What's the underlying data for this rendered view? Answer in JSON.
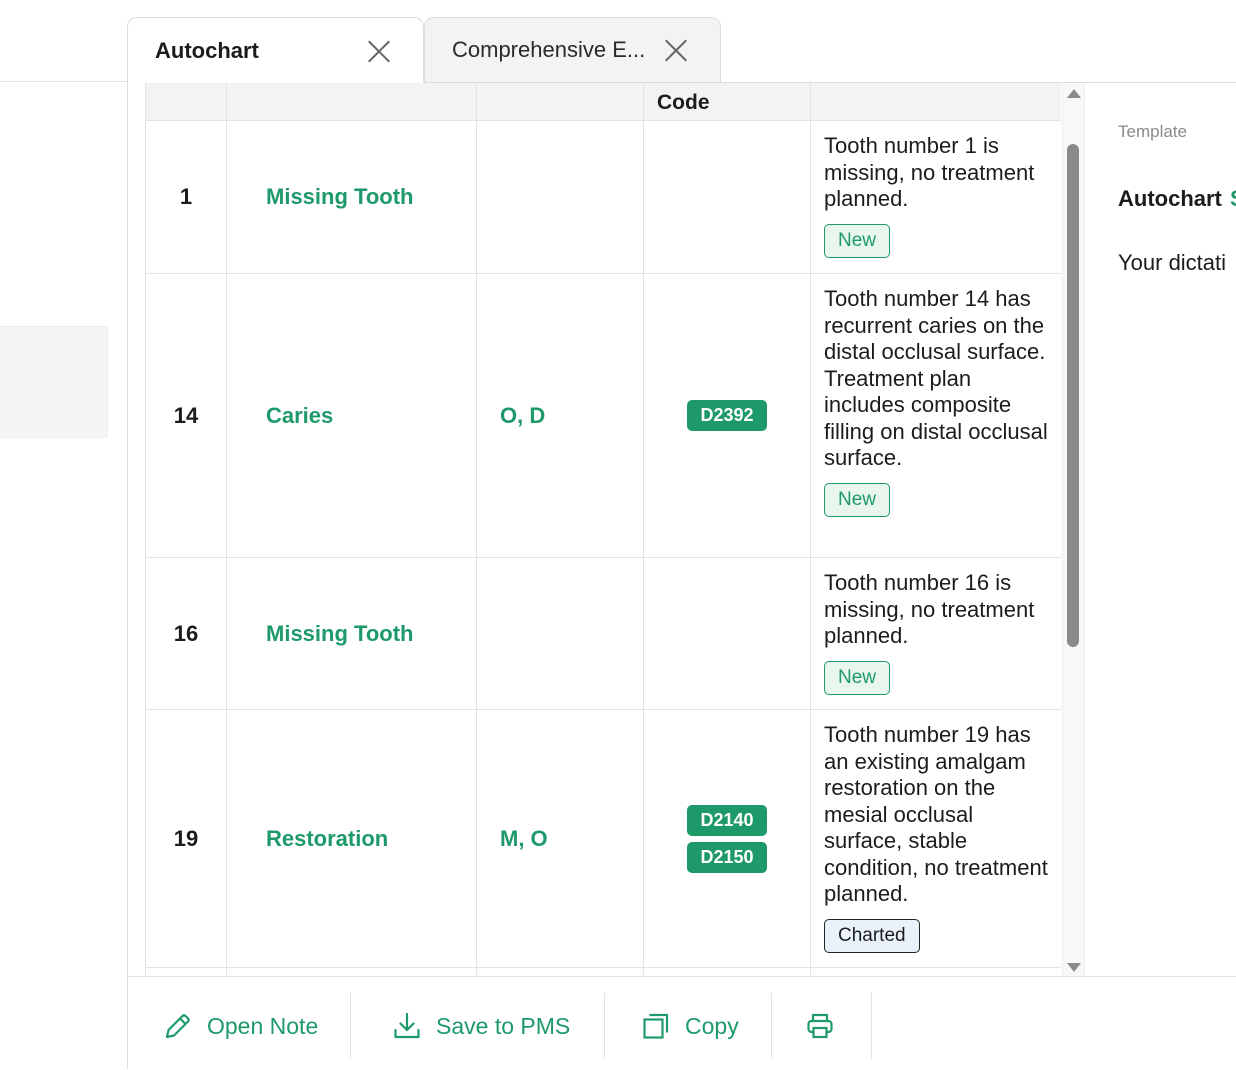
{
  "tabs": [
    {
      "label": "Autochart",
      "active": true
    },
    {
      "label": "Comprehensive E...",
      "active": false
    }
  ],
  "table": {
    "header_visible_label": "Code",
    "rows": [
      {
        "tooth": "1",
        "condition": "Missing Tooth",
        "surfaces": "",
        "codes": [],
        "note": "Tooth number 1 is missing, no treatment planned.",
        "status": "New"
      },
      {
        "tooth": "14",
        "condition": "Caries",
        "surfaces": "O, D",
        "codes": [
          "D2392"
        ],
        "note": "Tooth number 14 has recurrent caries on the distal occlusal surface. Treatment plan includes composite filling on distal occlusal surface.",
        "status": "New"
      },
      {
        "tooth": "16",
        "condition": "Missing Tooth",
        "surfaces": "",
        "codes": [],
        "note": "Tooth number 16 is missing, no treatment planned.",
        "status": "New"
      },
      {
        "tooth": "19",
        "condition": "Restoration",
        "surfaces": "M, O",
        "codes": [
          "D2140",
          "D2150"
        ],
        "note": "Tooth number 19 has an existing amalgam restoration on the mesial occlusal surface, stable condition, no treatment planned.",
        "status": "Charted"
      }
    ]
  },
  "right_panel": {
    "label": "Template",
    "title": "Autochart",
    "title_accent": "S",
    "body": "Your dictati"
  },
  "toolbar": {
    "open_note": "Open Note",
    "save_pms": "Save to PMS",
    "copy": "Copy",
    "print_icon": "printer-icon"
  },
  "colors": {
    "accent": "#1e9a6a",
    "badge_new_bg": "#e9f6ee",
    "badge_charted_bg": "#e9f2fb"
  }
}
